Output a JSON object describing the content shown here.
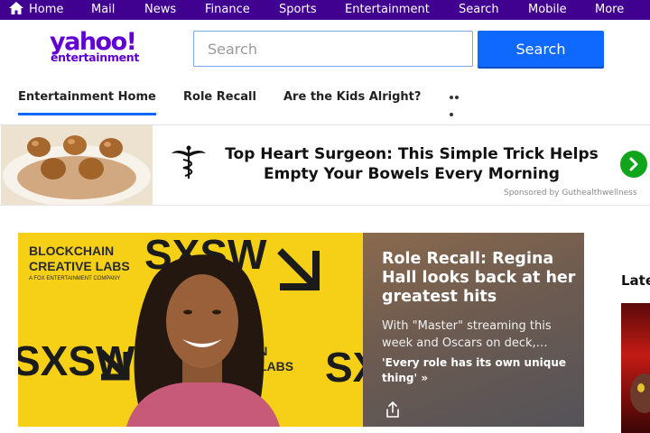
{
  "topnav": {
    "items": [
      "Home",
      "Mail",
      "News",
      "Finance",
      "Sports",
      "Entertainment",
      "Search",
      "Mobile",
      "More"
    ]
  },
  "header": {
    "logo_main": "yahoo!",
    "logo_sub": "entertainment",
    "search_placeholder": "Search",
    "search_button": "Search"
  },
  "subnav": {
    "tabs": [
      "Entertainment Home",
      "Role Recall",
      "Are the Kids Alright?"
    ]
  },
  "ad": {
    "headline": "Top Heart Surgeon: This Simple Trick Helps Empty Your Bowels Every Morning",
    "sponsor": "Sponsored by Guthealthwellness"
  },
  "hero": {
    "image_text_top": "BLOCKCHAIN CREATIVE LABS",
    "image_text_small": "A FOX ENTERTAINMENT COMPANY",
    "image_brand": "SXSW",
    "title": "Role Recall: Regina Hall looks back at her greatest hits",
    "summary": "With \"Master\" streaming this week and Oscars on deck,…",
    "link": "'Every role has its own unique thing' »"
  },
  "sidebar": {
    "heading": "Late"
  },
  "colors": {
    "brand": "#6001d2",
    "topbar": "#400090",
    "accent": "#0f69ff",
    "ad_arrow": "#11a51c"
  }
}
